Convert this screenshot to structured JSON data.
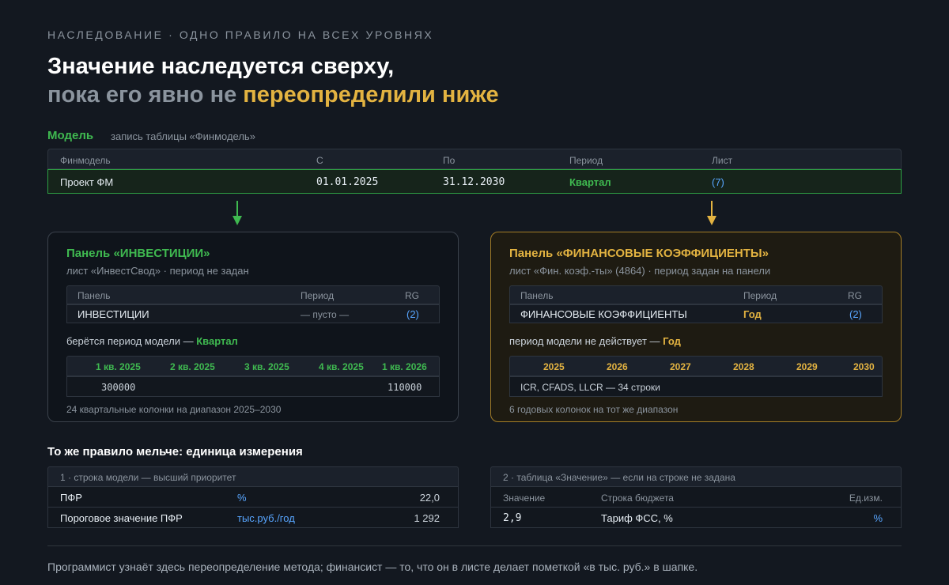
{
  "header": {
    "eyebrow": "НАСЛЕДОВАНИЕ · ОДНО ПРАВИЛО НА ВСЕХ УРОВНЯХ",
    "title_line1": "Значение наследуется сверху,",
    "title_line2_plain": "пока его явно не",
    "title_line2_accent": "переопределили ниже"
  },
  "model": {
    "label": "Модель",
    "subtitle": "запись таблицы «Финмодель»",
    "columns": [
      "Финмодель",
      "С",
      "По",
      "Период",
      "Лист"
    ],
    "row": {
      "finmodel": "Проект ФМ",
      "from": "01.01.2025",
      "to": "31.12.2030",
      "period": "Квартал",
      "sheet": "(7)"
    }
  },
  "panel_invest": {
    "title": "Панель «ИНВЕСТИЦИИ»",
    "subtitle": "лист «ИнвестСвод» · период не задан",
    "columns": [
      "Панель",
      "Период",
      "RG"
    ],
    "row": {
      "panel": "ИНВЕСТИЦИИ",
      "period": "— пусто —",
      "rg": "(2)"
    },
    "note_prefix": "берётся период модели —",
    "note_value": "Квартал",
    "quarters": [
      "1 кв. 2025",
      "2 кв. 2025",
      "3 кв. 2025",
      "4 кв. 2025",
      "1 кв. 2026"
    ],
    "values": [
      "300000",
      "110000"
    ],
    "footnote": "24 квартальные колонки на диапазон 2025–2030"
  },
  "panel_fin": {
    "title": "Панель «ФИНАНСОВЫЕ КОЭФФИЦИЕНТЫ»",
    "subtitle": "лист «Фин. коэф.-ты» (4864) · период задан на панели",
    "columns": [
      "Панель",
      "Период",
      "RG"
    ],
    "row": {
      "panel": "ФИНАНСОВЫЕ КОЭФФИЦИЕНТЫ",
      "period": "Год",
      "rg": "(2)"
    },
    "note_prefix": "период модели не действует —",
    "note_value": "Год",
    "years": [
      "2025",
      "2026",
      "2027",
      "2028",
      "2029",
      "2030"
    ],
    "rows_text": "ICR, CFADS, LLCR — 34 строки",
    "footnote": "6 годовых колонок на тот же диапазон"
  },
  "units": {
    "title": "То же правило мельче: единица измерения",
    "left": {
      "caption": "1 · строка модели — высший приоритет",
      "rows": [
        {
          "name": "ПФР",
          "unit": "%",
          "value": "22,0"
        },
        {
          "name": "Пороговое значение ПФР",
          "unit": "тыс.руб./год",
          "value": "1 292"
        }
      ]
    },
    "right": {
      "caption": "2 · таблица «Значение» — если на строке не задана",
      "columns": [
        "Значение",
        "Строка бюджета",
        "Ед.изм."
      ],
      "row": {
        "value": "2,9",
        "budget_line": "Тариф ФСС, %",
        "unit": "%"
      }
    }
  },
  "footer": {
    "text": "Программист узнаёт здесь переопределение метода; финансист — то, что он в листе делает пометкой «в тыс. руб.» в шапке."
  },
  "colors": {
    "background": "#131820",
    "accent_green": "#3fb950",
    "accent_gold": "#e3b341",
    "link_blue": "#58a6ff"
  }
}
